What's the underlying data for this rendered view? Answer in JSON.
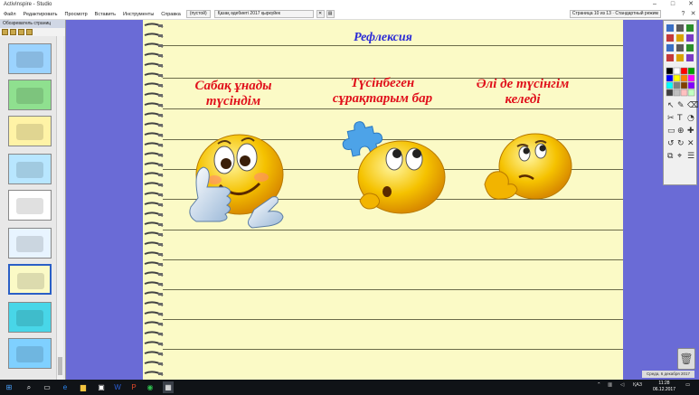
{
  "window": {
    "title": "ActivInspire - Studio",
    "controls": [
      "–",
      "□",
      "✕"
    ]
  },
  "menubar": {
    "items": [
      "Файл",
      "Редактировать",
      "Просмотр",
      "Вставить",
      "Инструменты",
      "Справка"
    ],
    "combo_left": "(пустой)",
    "combo_doc": "Қазақ әдебиеті 2017 қыркүйек",
    "pages_label": "Страница 10 из 13",
    "pages_extra": "Стандартный режим"
  },
  "browser": {
    "header": "Обозреватель страниц",
    "thumbs": [
      {
        "color": "#9bd3ff"
      },
      {
        "color": "#8fe08f"
      },
      {
        "color": "#fff3a6"
      },
      {
        "color": "#b8e6ff"
      },
      {
        "color": "#ffffff"
      },
      {
        "color": "#e8f4ff"
      },
      {
        "color": "#fbfac6"
      },
      {
        "color": "#48d6e8"
      },
      {
        "color": "#7fd0ff"
      }
    ]
  },
  "flipchart": {
    "title": "Рефлексия",
    "captions": [
      {
        "line1": "Сабақ ұнады",
        "line2": "түсіндім"
      },
      {
        "line1": "Түсінбеген",
        "line2": "сұрақтарым бар"
      },
      {
        "line1": "Әлі де түсінгім",
        "line2": "келеді"
      }
    ]
  },
  "toolbox": {
    "palette": [
      "#000000",
      "#ffffff",
      "#ff0000",
      "#00a000",
      "#0000ff",
      "#ffff00",
      "#ff8000",
      "#ff00ff",
      "#00ffff",
      "#808080",
      "#804000",
      "#8000ff",
      "#404040",
      "#c0c0c0",
      "#ffc0c0",
      "#c0ffc0"
    ]
  },
  "status": {
    "toast": "Среда, 6 декабря 2017"
  },
  "taskbar": {
    "lang": "ҚАЗ",
    "time": "11:28",
    "date": "06.12.2017"
  }
}
